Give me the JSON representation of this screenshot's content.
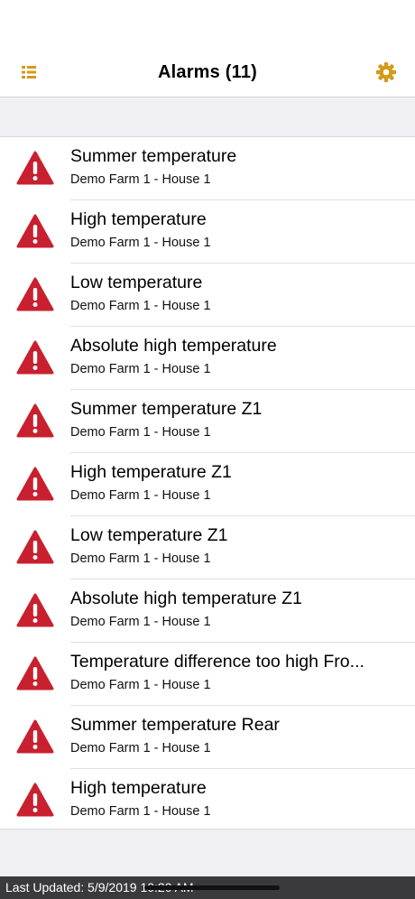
{
  "header": {
    "title": "Alarms (11)",
    "menu_icon": "list-icon",
    "settings_icon": "gear-icon",
    "accent_color": "#d39a1c"
  },
  "alarm_icon": "warning-triangle-icon",
  "alarm_color": "#c8202f",
  "alarms": [
    {
      "title": "Summer temperature",
      "location": "Demo Farm 1 - House 1"
    },
    {
      "title": "High temperature",
      "location": "Demo Farm 1 - House 1"
    },
    {
      "title": "Low temperature",
      "location": "Demo Farm 1 - House 1"
    },
    {
      "title": "Absolute high temperature",
      "location": "Demo Farm 1 - House 1"
    },
    {
      "title": "Summer temperature Z1",
      "location": "Demo Farm 1 - House 1"
    },
    {
      "title": "High temperature Z1",
      "location": "Demo Farm 1 - House 1"
    },
    {
      "title": "Low temperature Z1",
      "location": "Demo Farm 1 - House 1"
    },
    {
      "title": "Absolute high temperature Z1",
      "location": "Demo Farm 1 - House 1"
    },
    {
      "title": "Temperature difference too high Fro...",
      "location": "Demo Farm 1 - House 1"
    },
    {
      "title": "Summer temperature Rear",
      "location": "Demo Farm 1 - House 1"
    },
    {
      "title": "High temperature",
      "location": "Demo Farm 1 - House 1"
    }
  ],
  "footer": {
    "last_updated": "Last Updated: 5/9/2019 10:20 AM"
  }
}
